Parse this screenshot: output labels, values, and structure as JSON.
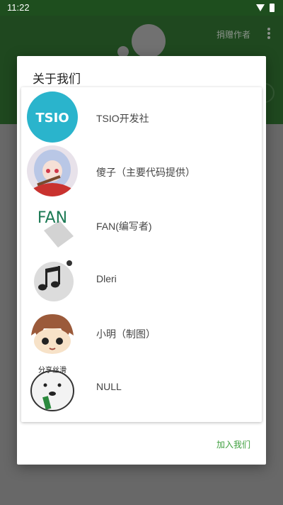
{
  "status_bar": {
    "time": "11:22"
  },
  "app_bar": {
    "donate_label": "捐赠作者"
  },
  "dialog": {
    "title": "关于我们",
    "members": [
      {
        "name": "TSIO开发社",
        "avatar": "tsio-logo-icon"
      },
      {
        "name": "傻子（主要代码提供）",
        "avatar": "anime-girl-avatar"
      },
      {
        "name": "FAN(编写者)",
        "avatar": "fan-text-avatar"
      },
      {
        "name": "Dleri",
        "avatar": "music-note-icon"
      },
      {
        "name": "小明（制图）",
        "avatar": "cartoon-boy-avatar"
      },
      {
        "name": "NULL",
        "avatar": "meme-face-avatar"
      }
    ],
    "avatar_texts": {
      "tsio": "TSIO",
      "fan": "FAN",
      "meme": "分享丝滑"
    },
    "join_button": "加入我们"
  },
  "colors": {
    "app_bar": "#2e6b2e",
    "status_bar": "#1e4e1e",
    "accent": "#3fa03f",
    "tsio_bg": "#2ab4cc"
  }
}
